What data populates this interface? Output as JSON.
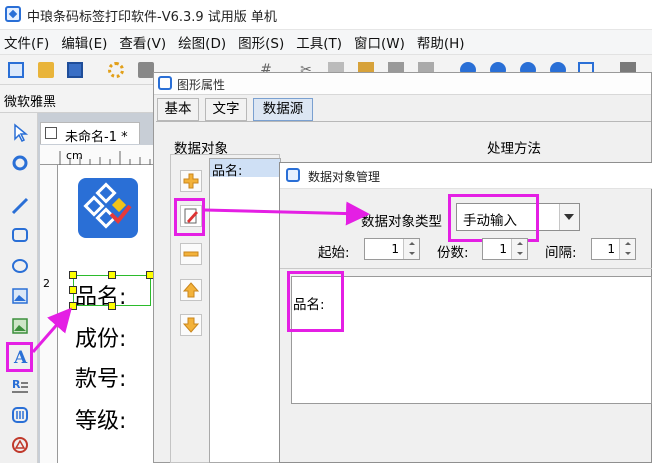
{
  "app": {
    "title": "中琅条码标签打印软件-V6.3.9 试用版 单机"
  },
  "menu": [
    "文件(F)",
    "编辑(E)",
    "查看(V)",
    "绘图(D)",
    "图形(S)",
    "工具(T)",
    "窗口(W)",
    "帮助(H)"
  ],
  "font": {
    "name": "微软雅黑"
  },
  "document": {
    "tab_label": "未命名-1 *",
    "ruler_unit": "cm",
    "ruler_number": "2"
  },
  "label_lines": [
    "品名:",
    "成份:",
    "款号:",
    "等级:"
  ],
  "properties_dialog": {
    "title": "图形属性",
    "tabs": [
      "基本",
      "文字",
      "数据源"
    ],
    "data_object_label": "数据对象",
    "process_label": "处理方法",
    "data_list_item": "品名:"
  },
  "manager_dialog": {
    "title": "数据对象管理",
    "type_label": "数据对象类型",
    "type_value": "手动输入",
    "start_label": "起始:",
    "start_value": "1",
    "copies_label": "份数:",
    "copies_value": "1",
    "interval_label": "间隔:",
    "interval_value": "1",
    "content": "品名:"
  },
  "colors": {
    "highlight": "#e41fe4",
    "accent": "#2a6fd6"
  }
}
